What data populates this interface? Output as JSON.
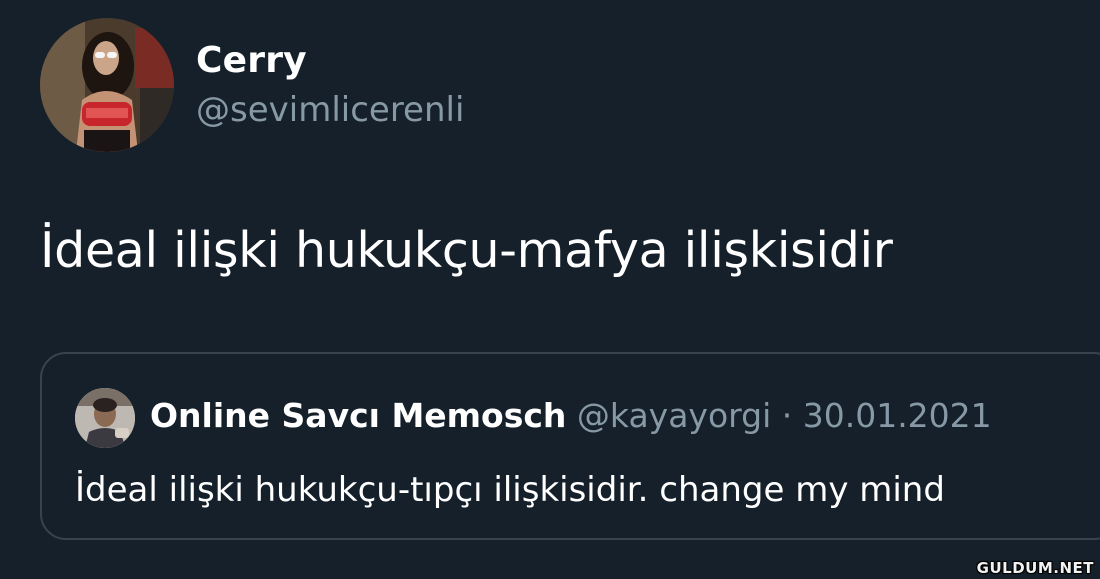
{
  "tweet": {
    "author": {
      "name": "Cerry",
      "handle": "@sevimlicerenli"
    },
    "text": "İdeal ilişki hukukçu-mafya ilişkisidir"
  },
  "quoted_tweet": {
    "author_name": "Online Savcı Memosch",
    "meta": "@kayayorgi · 30.01.2021",
    "text": "İdeal ilişki hukukçu-tıpçı ilişkisidir. change my mind"
  },
  "watermark": "GULDUM.NET",
  "colors": {
    "background": "#15202b",
    "primary_text": "#ffffff",
    "secondary_text": "#8899a6",
    "border": "#38444d"
  },
  "icons": {
    "main_avatar": "profile-photo",
    "quote_avatar": "profile-photo"
  }
}
